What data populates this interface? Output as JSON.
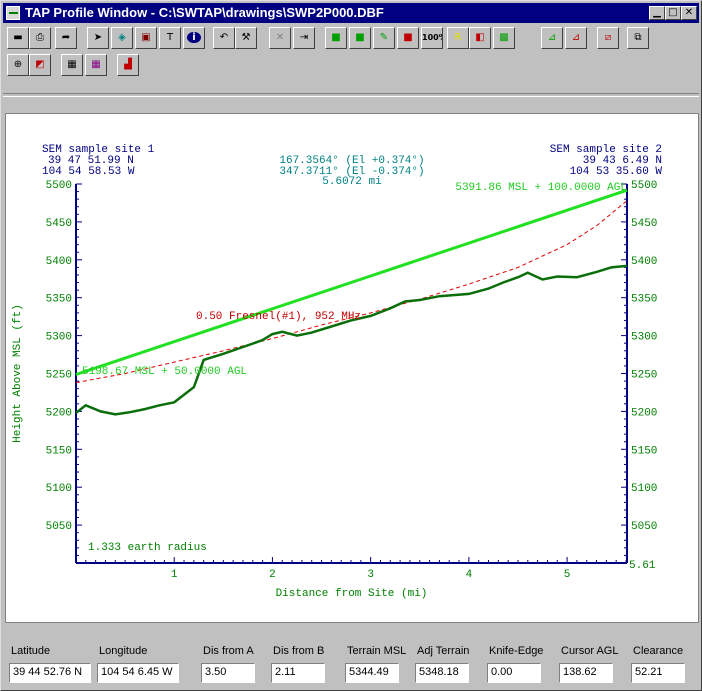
{
  "window": {
    "title": "TAP Profile Window - C:\\SWTAP\\drawings\\SWP2P000.DBF"
  },
  "toolbar1": [
    {
      "icon": "save-icon",
      "glyph": "▬",
      "color": "#000"
    },
    {
      "icon": "print-icon",
      "glyph": "⎙",
      "color": "#000"
    },
    {
      "icon": "forward-arrow-icon",
      "glyph": "➦",
      "color": "#000"
    },
    {
      "icon": "pointer-icon",
      "glyph": "➤",
      "color": "#000"
    },
    {
      "icon": "drawing-tool-icon",
      "glyph": "◈",
      "color": "#008080"
    },
    {
      "icon": "stamp-icon",
      "glyph": "▣",
      "color": "#800000"
    },
    {
      "icon": "text-tool-icon",
      "glyph": "T",
      "color": "#000"
    },
    {
      "icon": "info-icon",
      "glyph": "i",
      "color": "#fff"
    },
    {
      "icon": "undo-icon",
      "glyph": "↶",
      "color": "#000"
    },
    {
      "icon": "wrench-icon",
      "glyph": "⚒",
      "color": "#000"
    },
    {
      "icon": "delete-icon",
      "glyph": "✕",
      "color": "#808080"
    },
    {
      "icon": "exit-icon",
      "glyph": "⇥",
      "color": "#000"
    },
    {
      "icon": "green-square-icon",
      "glyph": "■",
      "color": "#00a000"
    },
    {
      "icon": "green-dot-icon",
      "glyph": "■",
      "color": "#00a000"
    },
    {
      "icon": "pin-icon",
      "glyph": "✎",
      "color": "#00a000"
    },
    {
      "icon": "red-square-icon",
      "glyph": "■",
      "color": "#c00000"
    },
    {
      "icon": "zoom-100-icon",
      "glyph": "100%",
      "color": "#000"
    },
    {
      "icon": "r-icon",
      "glyph": "R",
      "color": "#e0e000"
    },
    {
      "icon": "red-box-icon",
      "glyph": "◧",
      "color": "#c00000"
    },
    {
      "icon": "green-box-icon",
      "glyph": "▩",
      "color": "#00a000"
    },
    {
      "icon": "profile-icon",
      "glyph": "⊿",
      "color": "#00a000"
    },
    {
      "icon": "terrain-icon",
      "glyph": "⊿",
      "color": "#c00000"
    },
    {
      "icon": "fresnel-icon",
      "glyph": "⧄",
      "color": "#c00000"
    },
    {
      "icon": "copy-icon",
      "glyph": "⧉",
      "color": "#000"
    }
  ],
  "toolbar2": [
    {
      "icon": "crosshair-icon",
      "glyph": "⊕",
      "color": "#000"
    },
    {
      "icon": "layers-icon",
      "glyph": "◩",
      "color": "#c00000"
    },
    {
      "icon": "grid-icon",
      "glyph": "▦",
      "color": "#000"
    },
    {
      "icon": "color-grid-icon",
      "glyph": "▦",
      "color": "#800080"
    },
    {
      "icon": "histogram-icon",
      "glyph": "▟",
      "color": "#c00000"
    }
  ],
  "plot": {
    "site1_label": "SEM sample site 1",
    "site1_lat": "39 47 51.99 N",
    "site1_lon": "104 54 58.53 W",
    "site2_label": "SEM sample site 2",
    "site2_lat": "39 43 6.49 N",
    "site2_lon": "104 53 35.60 W",
    "azimuth1": "167.3564° (El +0.374°)",
    "azimuth2": "347.3711° (El -0.374°)",
    "distance": "5.6072 mi",
    "right_antenna": "5391.86 MSL + 100.0000 AGL",
    "left_antenna": "5198.67 MSL + 50.0000 AGL",
    "fresnel_label": "0.50 Fresnel(#1), 952 MHz",
    "earth_radius": "1.333 earth radius",
    "xmax_label": "5.61"
  },
  "chart_data": {
    "type": "line",
    "xlabel": "Distance from Site (mi)",
    "ylabel": "Height Above MSL (ft)",
    "xlim": [
      0,
      5.61
    ],
    "ylim": [
      5000,
      5500
    ],
    "x_ticks": [
      "1",
      "2",
      "3",
      "4",
      "5"
    ],
    "y_ticks": [
      "5500",
      "5450",
      "5400",
      "5350",
      "5300",
      "5250",
      "5200",
      "5150",
      "5100",
      "5050"
    ],
    "grid": false,
    "colors": {
      "terrain": "#0a6f0a",
      "los": "#22e022",
      "fresnel": "#e00000",
      "axis": "#000080",
      "tick_text": "#008000"
    },
    "series": [
      {
        "role": "terrain",
        "x": [
          0,
          0.1,
          0.25,
          0.4,
          0.55,
          0.7,
          0.85,
          1.0,
          1.1,
          1.2,
          1.3,
          1.5,
          1.7,
          1.9,
          2.0,
          2.1,
          2.25,
          2.4,
          2.6,
          2.8,
          3.0,
          3.2,
          3.35,
          3.5,
          3.7,
          4.0,
          4.2,
          4.35,
          4.5,
          4.6,
          4.75,
          4.9,
          5.1,
          5.3,
          5.45,
          5.61
        ],
        "y": [
          5198,
          5208,
          5200,
          5196,
          5199,
          5203,
          5208,
          5212,
          5222,
          5232,
          5268,
          5276,
          5285,
          5294,
          5302,
          5305,
          5300,
          5304,
          5312,
          5320,
          5326,
          5336,
          5345,
          5347,
          5352,
          5355,
          5362,
          5370,
          5377,
          5383,
          5374,
          5378,
          5377,
          5384,
          5390,
          5392
        ]
      },
      {
        "role": "line-of-sight",
        "x": [
          0,
          5.61
        ],
        "y": [
          5248.67,
          5491.86
        ]
      },
      {
        "role": "fresnel",
        "x": [
          0,
          0.5,
          1.0,
          1.5,
          2.0,
          2.5,
          3.0,
          3.5,
          4.0,
          4.5,
          5.0,
          5.3,
          5.61
        ],
        "y": [
          5238,
          5250,
          5265,
          5280,
          5296,
          5314,
          5330,
          5348,
          5368,
          5390,
          5420,
          5445,
          5478
        ]
      }
    ]
  },
  "status": [
    {
      "label": "Latitude",
      "value": "39 44 52.76 N"
    },
    {
      "label": "Longitude",
      "value": "104 54 6.45 W"
    },
    {
      "label": "Dis from A",
      "value": "3.50"
    },
    {
      "label": "Dis from B",
      "value": "2.11"
    },
    {
      "label": "Terrain MSL",
      "value": "5344.49"
    },
    {
      "label": "Adj Terrain",
      "value": "5348.18"
    },
    {
      "label": "Knife-Edge",
      "value": "0.00"
    },
    {
      "label": "Cursor AGL",
      "value": "138.62"
    },
    {
      "label": "Clearance",
      "value": "52.21"
    }
  ]
}
